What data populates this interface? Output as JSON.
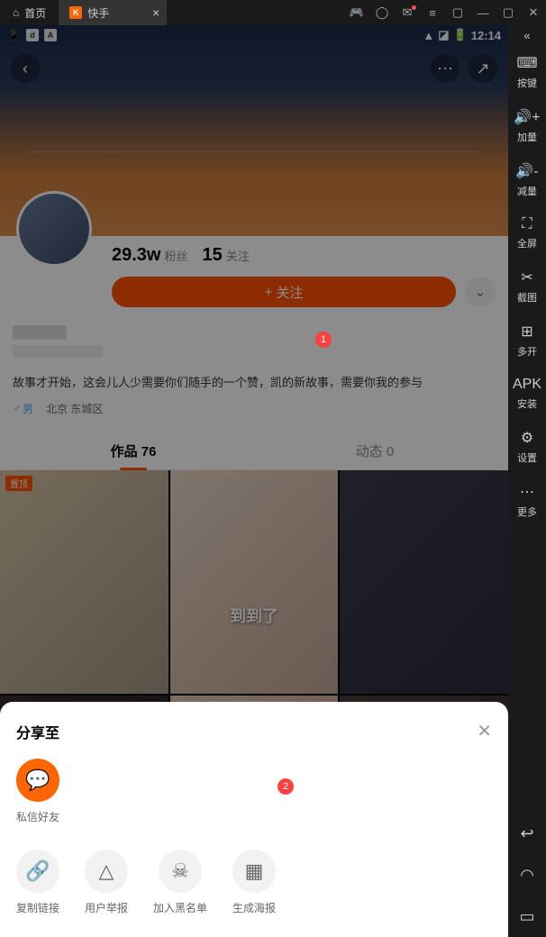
{
  "emulator": {
    "home_label": "首页",
    "app_name": "快手",
    "rail": {
      "keys": "按键",
      "vol_up": "加量",
      "vol_down": "减量",
      "fullscreen": "全屏",
      "screenshot": "截图",
      "multi": "多开",
      "install": "安装",
      "settings": "设置",
      "more": "更多"
    }
  },
  "status": {
    "time": "12:14"
  },
  "profile": {
    "fans_num": "29.3w",
    "fans_label": "粉丝",
    "follow_num": "15",
    "follow_label": "关注",
    "follow_btn": "关注",
    "bio": "故事才开始，这会儿人少需要你们随手的一个赞，凯的新故事，需要你我的参与",
    "gender": "男",
    "location": "北京 东城区",
    "tab_works": "作品 76",
    "tab_moments": "动态 0",
    "pin_label": "置顶",
    "cell2_text": "到到了"
  },
  "sheet": {
    "title": "分享至",
    "dm": "私信好友",
    "copy": "复制链接",
    "report": "用户举报",
    "blacklist": "加入黑名单",
    "poster": "生成海报"
  },
  "anno": {
    "n1": "1",
    "n2": "2"
  }
}
